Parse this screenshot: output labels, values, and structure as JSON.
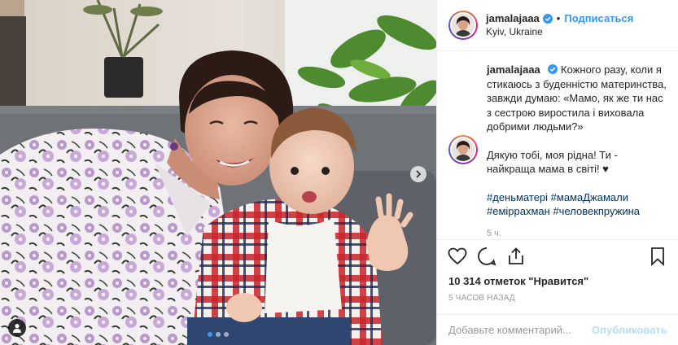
{
  "post": {
    "username": "jamalajaaa",
    "follow_label": "Подписаться",
    "location": "Kyiv, Ukraine",
    "caption_line": "Кожного разу, коли я стикаюсь з буденністю материнства, завжди думаю: «Мамо, як же ти нас з сестрою виростила і виховала добрими людьми?»",
    "caption_thanks": "Дякую тобі, моя рідна! Ти - найкраща мама в світі! ♥",
    "hashtags": [
      "#деньматері",
      "#мамаДжамали",
      "#еміррахман",
      "#человекпружина"
    ],
    "comment_time": "5 ч.",
    "likes_text": "10 314 отметок \"Нравится\"",
    "posted_ago": "5 ЧАСОВ НАЗАД",
    "add_comment_placeholder": "Добавьте комментарий...",
    "publish_label": "Опубликовать"
  },
  "carousel": {
    "total_slides": 3,
    "active_slide": 1
  },
  "icons": {
    "verified": "verified-badge-icon",
    "like": "heart-icon",
    "comment": "comment-bubble-icon",
    "share": "share-icon",
    "save": "bookmark-icon",
    "next": "chevron-right-icon",
    "tagged": "person-tag-icon"
  },
  "colors": {
    "link_blue": "#3897f0",
    "hashtag": "#003569",
    "muted": "#999999",
    "publish_disabled": "#b2dffc"
  }
}
